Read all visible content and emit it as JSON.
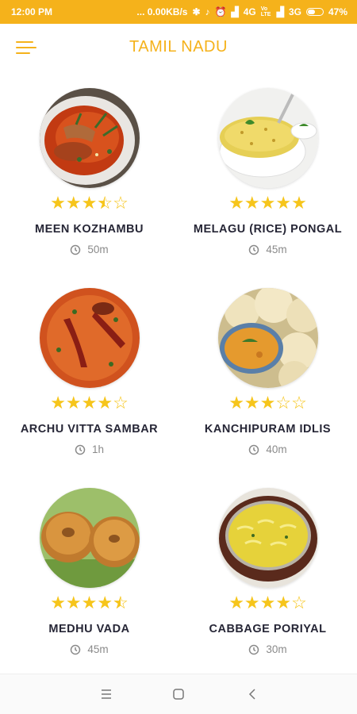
{
  "status_bar": {
    "time": "12:00 PM",
    "net_speed": "... 0.00KB/s",
    "signal_4g": "4G",
    "volte": "Vo LTE",
    "signal_3g": "3G",
    "battery": "47%"
  },
  "app_bar": {
    "title": "TAMIL NADU"
  },
  "recipes": [
    {
      "name": "MEEN KOZHAMBU",
      "time": "50m",
      "rating": 3.5
    },
    {
      "name": "MELAGU (RICE) PONGAL",
      "time": "45m",
      "rating": 5
    },
    {
      "name": "ARCHU VITTA SAMBAR",
      "time": "1h",
      "rating": 4
    },
    {
      "name": "KANCHIPURAM IDLIS",
      "time": "40m",
      "rating": 3
    },
    {
      "name": "MEDHU VADA",
      "time": "45m",
      "rating": 4.5
    },
    {
      "name": "CABBAGE PORIYAL",
      "time": "30m",
      "rating": 4
    }
  ],
  "colors": {
    "accent": "#f5b21b",
    "star": "#f6c51b",
    "text": "#262636",
    "muted": "#8a8a8a"
  }
}
